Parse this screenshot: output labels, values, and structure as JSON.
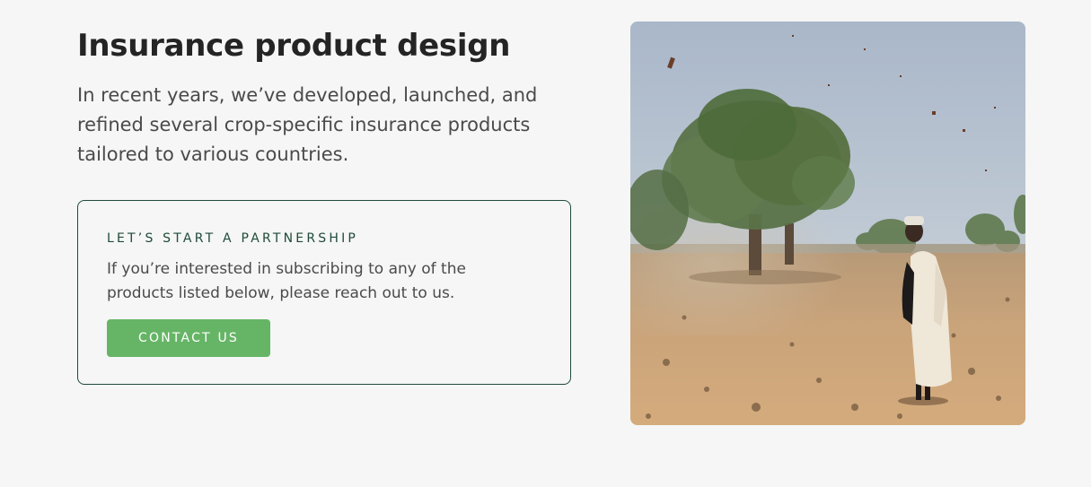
{
  "hero": {
    "title": "Insurance product design",
    "intro": "In recent years, we’ve developed, launched, and refined several crop-specific insurance products tailored to various countries."
  },
  "partnership": {
    "eyebrow": "LET’S START A PARTNERSHIP",
    "text": "If you’re interested in subscribing to any of the products listed below, please reach out to us.",
    "cta_label": "CONTACT US",
    "accent_color": "#66b566",
    "border_color": "#1f4a3a"
  },
  "image": {
    "alt": "Man in white robe standing in a dusty dry field with trees and blowing debris"
  }
}
